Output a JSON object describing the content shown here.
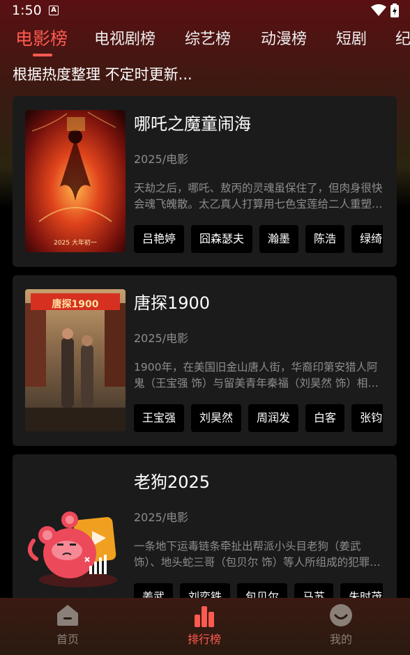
{
  "status": {
    "time": "1:50",
    "notif": "A"
  },
  "tabs": [
    {
      "label": "电影榜"
    },
    {
      "label": "电视剧榜"
    },
    {
      "label": "综艺榜"
    },
    {
      "label": "动漫榜"
    },
    {
      "label": "短剧"
    },
    {
      "label": "纪"
    }
  ],
  "subtitle": "根据热度整理 不定时更新...",
  "cards": [
    {
      "title": "哪吒之魔童闹海",
      "meta": "2025/电影",
      "desc": "天劫之后，哪吒、敖丙的灵魂虽保住了，但肉身很快会魂飞魄散。太乙真人打算用七色宝莲给二人重塑肉身。",
      "cast": [
        "吕艳婷",
        "囧森瑟夫",
        "瀚墨",
        "陈浩",
        "绿绮"
      ],
      "poster_text": "2025 大年初一"
    },
    {
      "title": "唐探1900",
      "meta": "2025/电影",
      "desc": "1900年，在美国旧金山唐人街，华裔印第安猎人阿鬼（王宝强 饰）与留美青年秦福（刘昊然 饰）相遇。",
      "cast": [
        "王宝强",
        "刘昊然",
        "周润发",
        "白客",
        "张钧甯"
      ],
      "poster_text": "唐探1900"
    },
    {
      "title": "老狗2025",
      "meta": "2025/电影",
      "desc": "一条地下运毒链条牵扯出帮派小头目老狗（姜武 饰）、地头蛇三哥（包贝尔 饰）等人所组成的犯罪团伙。",
      "cast": [
        "姜武",
        "刘奕铁",
        "包贝尔",
        "马苏",
        "朱时茂"
      ],
      "poster_text": ""
    }
  ],
  "bottom_nav": [
    {
      "label": "首页"
    },
    {
      "label": "排行榜"
    },
    {
      "label": "我的"
    }
  ],
  "colors": {
    "accent": "#ff5a50",
    "card_bg": "#1b1b1b",
    "muted": "#8d8d8d"
  }
}
